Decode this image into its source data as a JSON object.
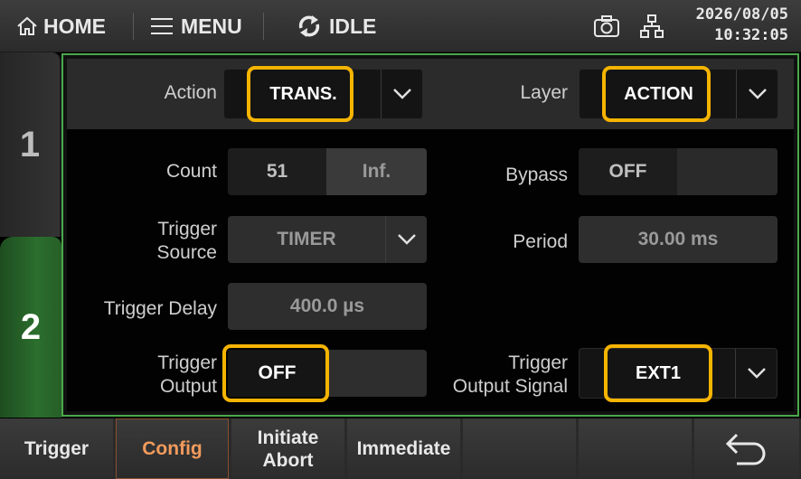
{
  "header": {
    "home_label": "HOME",
    "menu_label": "MENU",
    "status_label": "IDLE",
    "date": "2026/08/05",
    "time": "10:32:05"
  },
  "side_tabs": [
    "1",
    "2"
  ],
  "top_row": {
    "action_label": "Action",
    "action_value": "TRANS.",
    "layer_label": "Layer",
    "layer_value": "ACTION"
  },
  "fields": {
    "count_label": "Count",
    "count_value": "51",
    "count_inf": "Inf.",
    "bypass_label": "Bypass",
    "bypass_value": "OFF",
    "trigger_source_label_1": "Trigger",
    "trigger_source_label_2": "Source",
    "trigger_source_value": "TIMER",
    "period_label": "Period",
    "period_value": "30.00 ms",
    "trigger_delay_label": "Trigger Delay",
    "trigger_delay_value": "400.0 µs",
    "trigger_output_label_1": "Trigger",
    "trigger_output_label_2": "Output",
    "trigger_output_value": "OFF",
    "trigger_output_signal_label_1": "Trigger",
    "trigger_output_signal_label_2": "Output Signal",
    "trigger_output_signal_value": "EXT1"
  },
  "softkeys": [
    {
      "label": "Trigger"
    },
    {
      "label": "Config"
    },
    {
      "label_1": "Initiate",
      "label_2": "Abort"
    },
    {
      "label": "Immediate"
    }
  ],
  "colors": {
    "highlight": "#f5b400",
    "active_tab": "#2b6e2d",
    "active_softkey": "#f29b5c"
  }
}
